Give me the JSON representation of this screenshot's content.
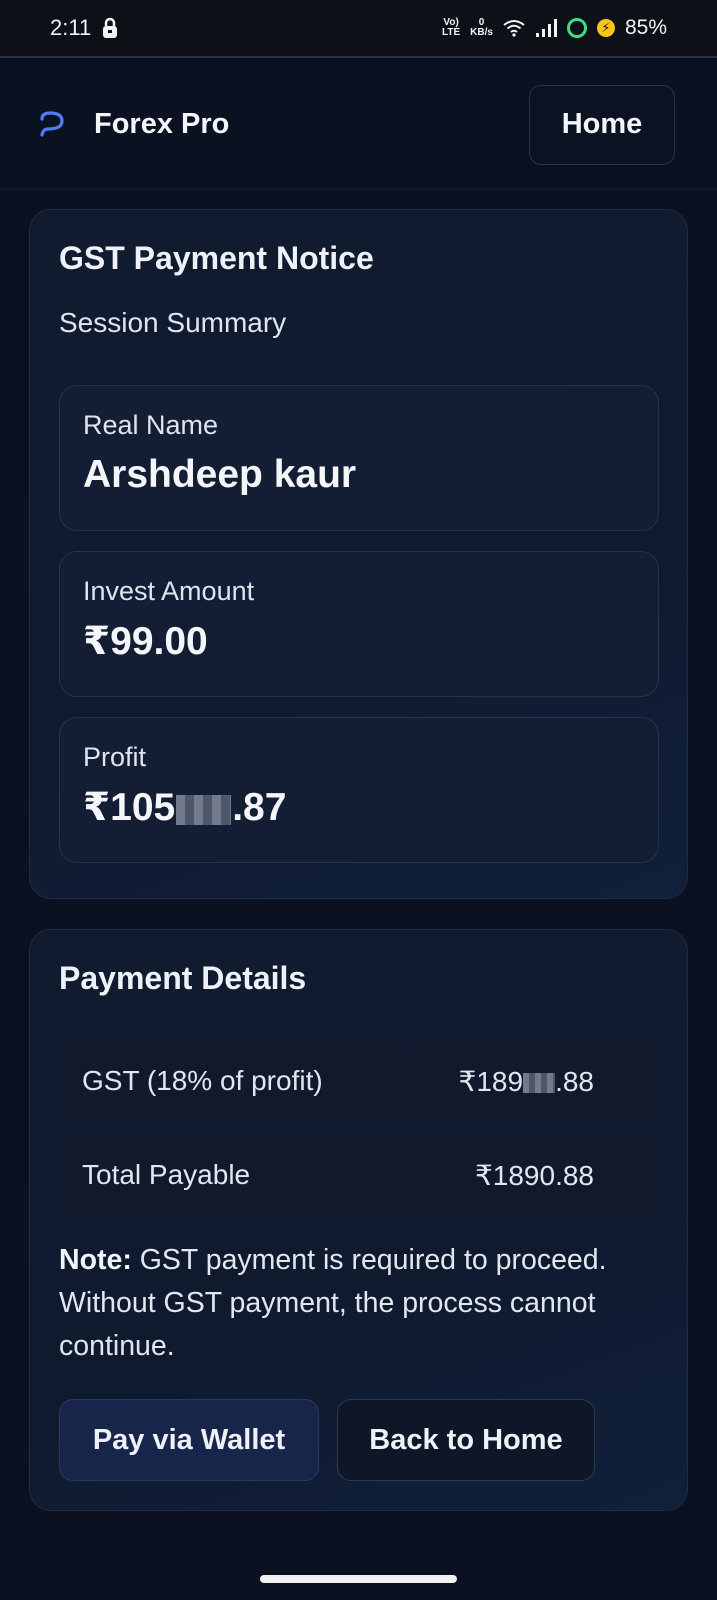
{
  "status_bar": {
    "time": "2:11",
    "network_label_top": "Vo)",
    "network_label_bottom": "LTE",
    "speed_value": "0",
    "speed_unit": "KB/s",
    "battery": "85%"
  },
  "header": {
    "brand": "Forex Pro",
    "home_label": "Home"
  },
  "notice": {
    "title": "GST Payment Notice",
    "subtitle": "Session Summary",
    "real_name_label": "Real Name",
    "real_name_value": "Arshdeep kaur",
    "invest_label": "Invest Amount",
    "invest_value": "₹99.00",
    "profit_label": "Profit",
    "profit_prefix": "₹105",
    "profit_suffix": ".87"
  },
  "payment": {
    "title": "Payment Details",
    "gst_label": "GST (18% of profit)",
    "gst_prefix": "₹189",
    "gst_suffix": ".88",
    "total_label": "Total Payable",
    "total_value": "₹1890.88",
    "note_bold": "Note:",
    "note_text": " GST payment is required to proceed. Without GST payment, the process cannot continue.",
    "wallet_button": "Pay via Wallet",
    "back_button": "Back to Home"
  },
  "colors": {
    "background": "#0b1120",
    "accent": "#4f7cf7",
    "card": "#111b30"
  }
}
